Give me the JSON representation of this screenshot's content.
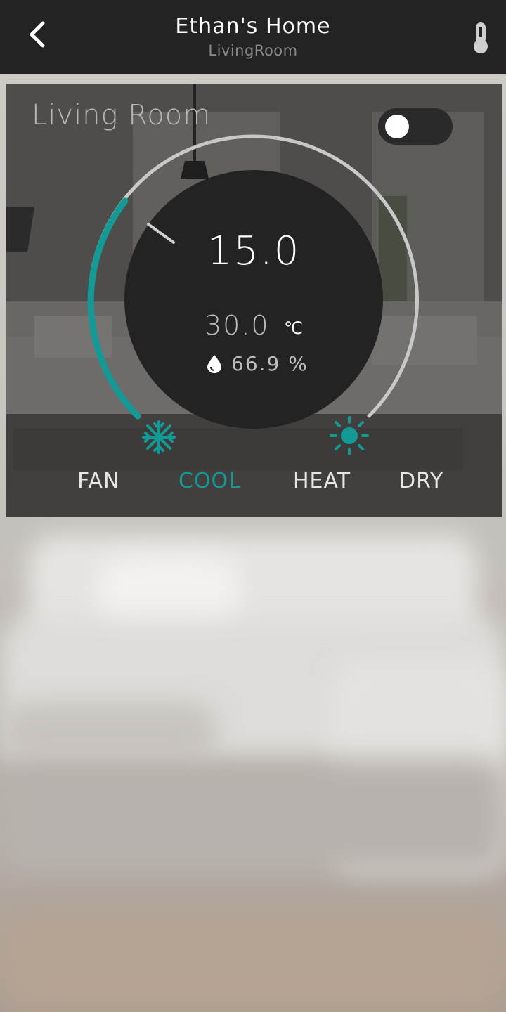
{
  "header": {
    "title": "Ethan's Home",
    "subtitle": "LivingRoom",
    "back_icon": "chevron-left-icon",
    "right_icon": "thermometer-icon"
  },
  "card": {
    "room_name": "Living Room",
    "power_on": false,
    "setpoint": "15.0",
    "current_temp": "30.0",
    "temp_unit": "℃",
    "humidity": "66.9 %",
    "modes": [
      "FAN",
      "COOL",
      "HEAT",
      "DRY"
    ],
    "active_mode": "COOL",
    "cool_icon": "snowflake-icon",
    "heat_icon": "sun-icon"
  },
  "colors": {
    "accent": "#139a96",
    "topbar": "#232323",
    "dial": "#232323"
  }
}
